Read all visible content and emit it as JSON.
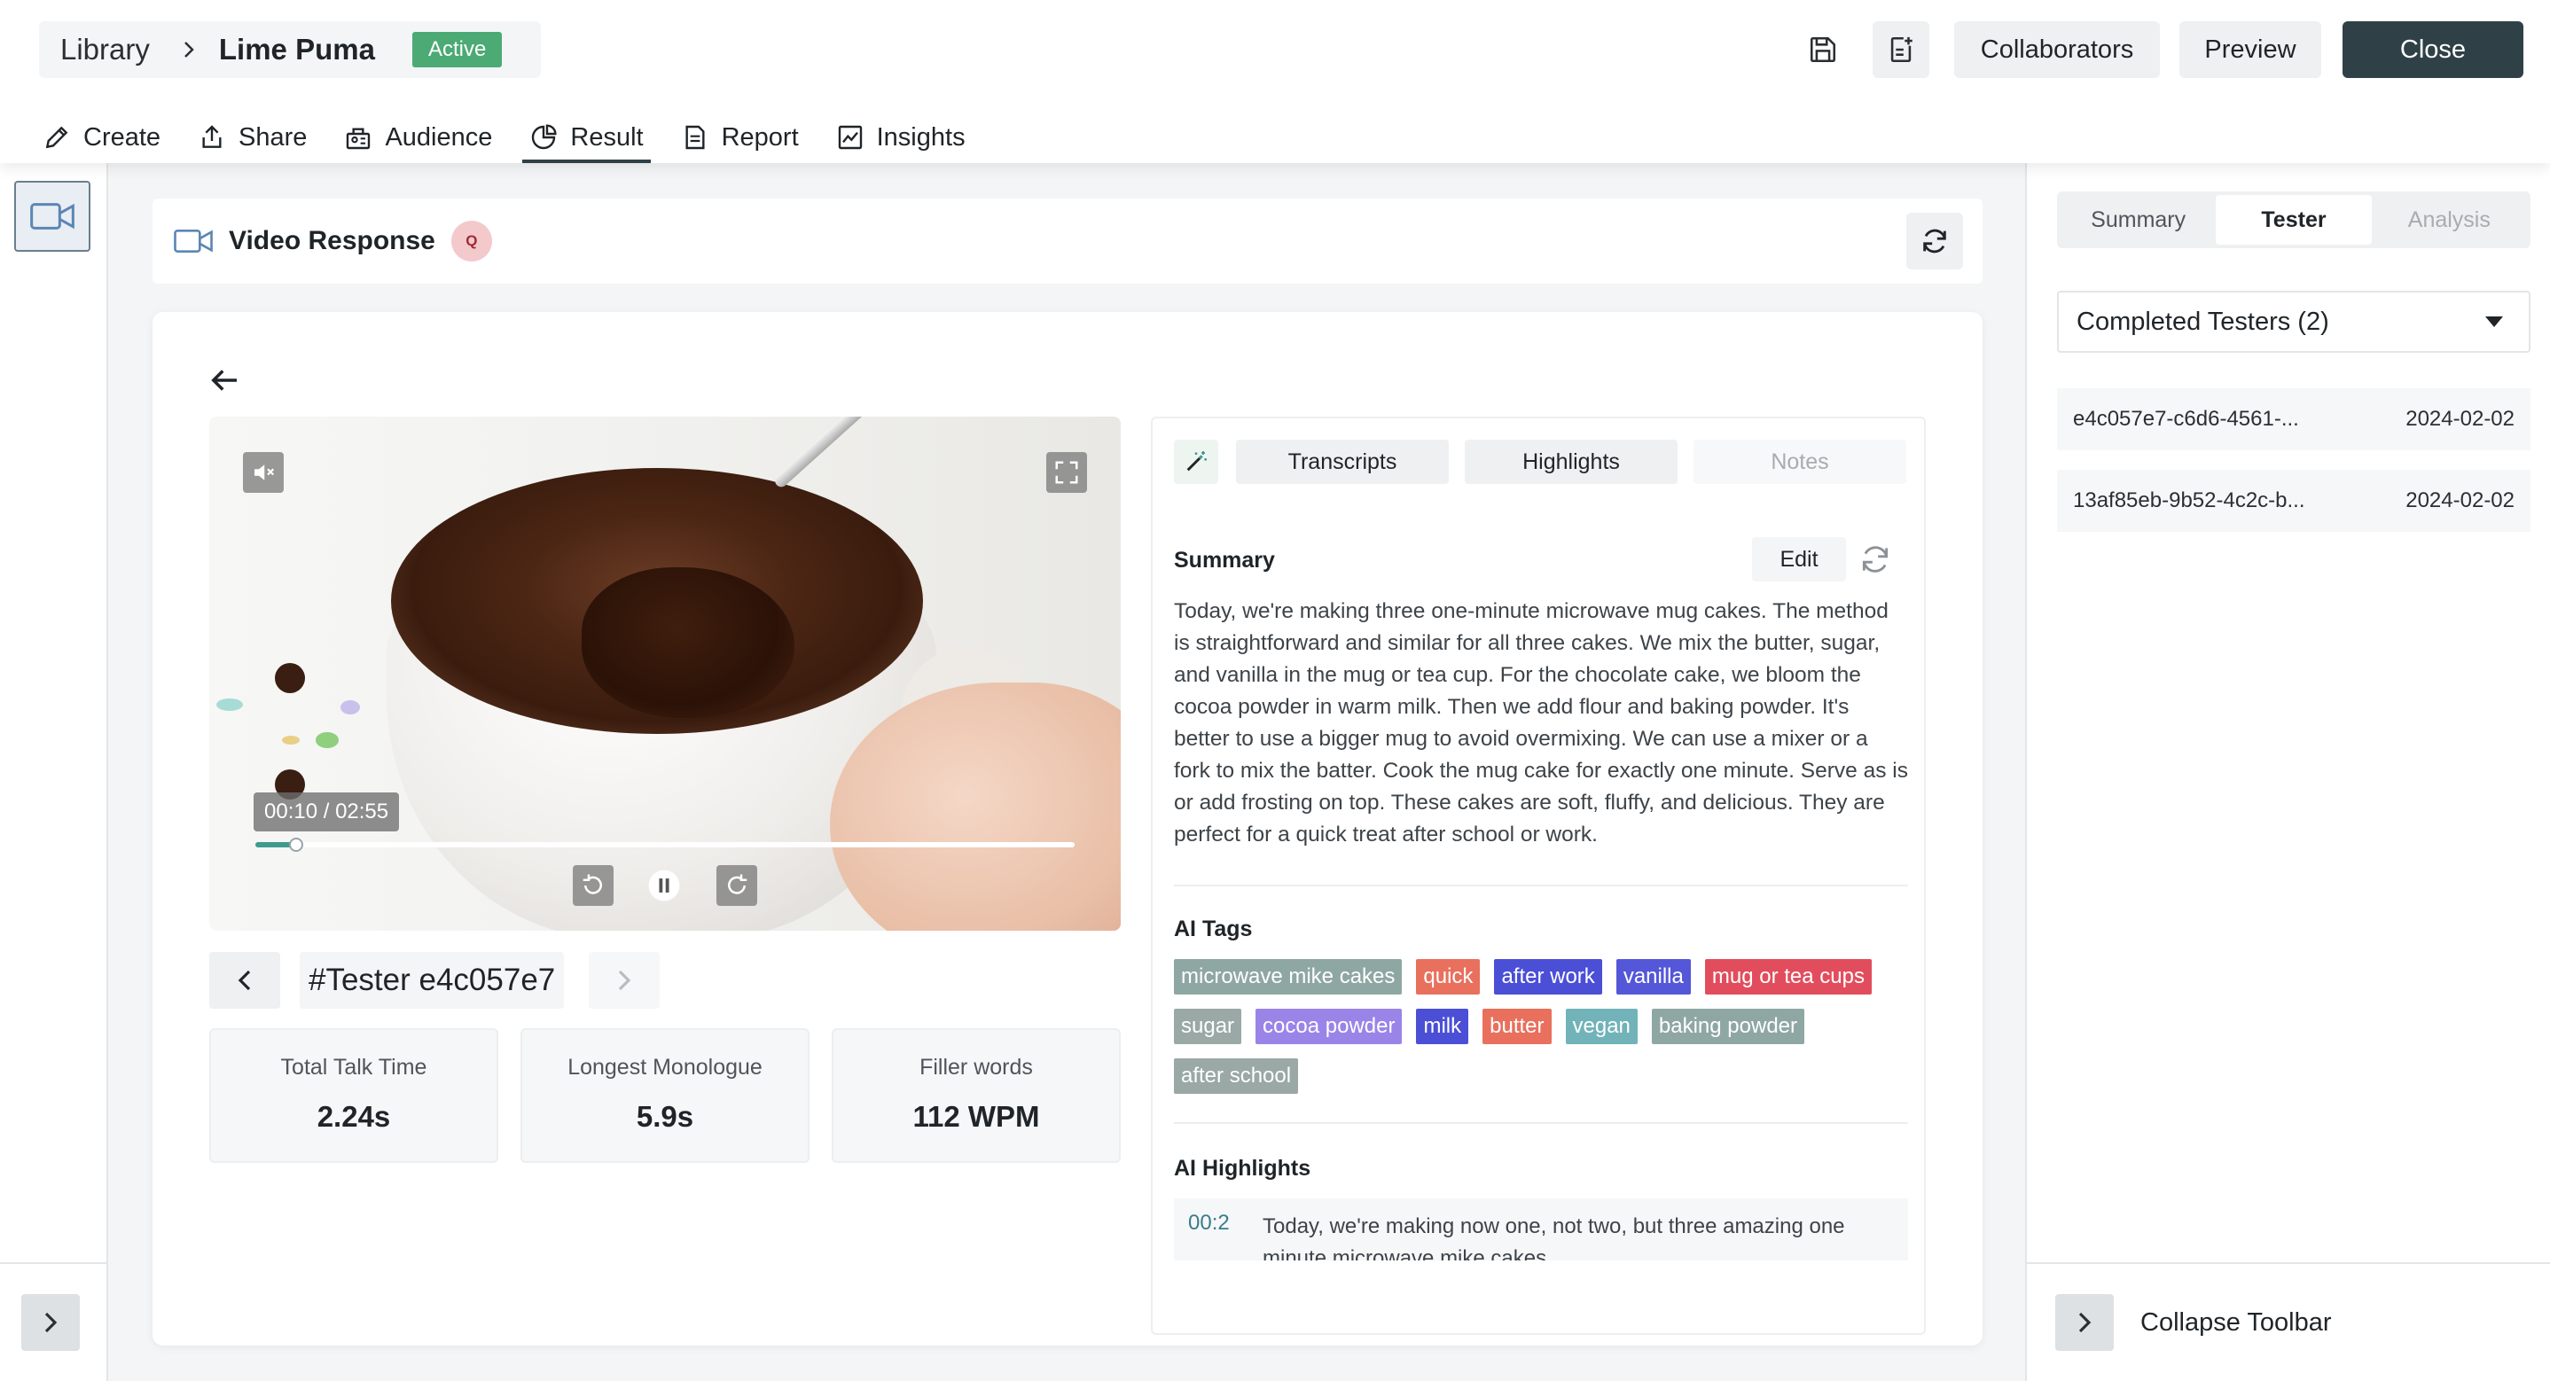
{
  "header": {
    "breadcrumb_root": "Library",
    "project_name": "Lime Puma",
    "status": "Active",
    "buttons": {
      "collaborators": "Collaborators",
      "preview": "Preview",
      "close": "Close"
    }
  },
  "nav": {
    "items": [
      {
        "label": "Create",
        "icon": "pencil-icon"
      },
      {
        "label": "Share",
        "icon": "share-icon"
      },
      {
        "label": "Audience",
        "icon": "audience-icon"
      },
      {
        "label": "Result",
        "icon": "pie-chart-icon",
        "active": true
      },
      {
        "label": "Report",
        "icon": "document-icon"
      },
      {
        "label": "Insights",
        "icon": "trend-chart-icon"
      }
    ]
  },
  "response": {
    "title": "Video Response",
    "badge": "Q"
  },
  "video": {
    "time": "00:10 / 02:55",
    "progress": 0.05
  },
  "tester": {
    "label": "#Tester e4c057e7"
  },
  "stats": [
    {
      "label": "Total Talk Time",
      "value": "2.24s"
    },
    {
      "label": "Longest Monologue",
      "value": "5.9s"
    },
    {
      "label": "Filler words",
      "value": "112 WPM"
    }
  ],
  "analysis": {
    "tabs": {
      "transcripts": "Transcripts",
      "highlights": "Highlights",
      "notes": "Notes"
    },
    "summary_title": "Summary",
    "edit_label": "Edit",
    "summary_text": "Today, we're making three one-minute microwave mug cakes. The method is straightforward and similar for all three cakes. We mix the butter, sugar, and vanilla in the mug or tea cup. For the chocolate cake, we bloom the cocoa powder in warm milk. Then we add flour and baking powder. It's better to use a bigger mug to avoid overmixing. We can use a mixer or a fork to mix the batter. Cook the mug cake for exactly one minute. Serve as is or add frosting on top. These cakes are soft, fluffy, and delicious. They are perfect for a quick treat after school or work.",
    "tags_title": "AI Tags",
    "tags": [
      {
        "label": "microwave mike cakes",
        "color": "#8fa7a3"
      },
      {
        "label": "quick",
        "color": "#e8705d"
      },
      {
        "label": "after work",
        "color": "#4b4fd6"
      },
      {
        "label": "vanilla",
        "color": "#5457d8"
      },
      {
        "label": "mug or tea cups",
        "color": "#e24d5d"
      },
      {
        "label": "sugar",
        "color": "#9aa8a6"
      },
      {
        "label": "cocoa powder",
        "color": "#9b84e8"
      },
      {
        "label": "milk",
        "color": "#4b4fd6"
      },
      {
        "label": "butter",
        "color": "#e8705d"
      },
      {
        "label": "vegan",
        "color": "#71b3b8"
      },
      {
        "label": "baking powder",
        "color": "#8fa7a3"
      },
      {
        "label": "after school",
        "color": "#9aa8a6"
      }
    ],
    "highlights_title": "AI Highlights",
    "highlight": {
      "time": "00:2",
      "text": "Today, we're making now one, not two, but three amazing one minute microwave mike cakes."
    }
  },
  "sidebar": {
    "tabs": {
      "summary": "Summary",
      "tester": "Tester",
      "analysis": "Analysis"
    },
    "dropdown": "Completed Testers (2)",
    "testers": [
      {
        "id": "e4c057e7-c6d6-4561-...",
        "date": "2024-02-02"
      },
      {
        "id": "13af85eb-9b52-4c2c-b...",
        "date": "2024-02-02"
      }
    ],
    "collapse_label": "Collapse Toolbar"
  }
}
